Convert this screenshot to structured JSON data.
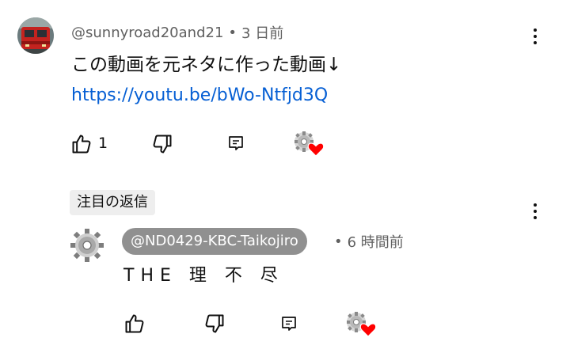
{
  "comment": {
    "author": "@sunnyroad20and21",
    "separator": "•",
    "time": "3 日前",
    "text": "この動画を元ネタに作った動画↓",
    "link": "https://youtu.be/bWo-Ntfjd3Q",
    "like_count": "1",
    "avatar_icon": "train-photo-avatar",
    "creator_heart_icon": "creator-heart-icon"
  },
  "reply": {
    "pinned_label": "注目の返信",
    "author": "@ND0429-KBC-Taikojiro",
    "separator": "•",
    "time": "6 時間前",
    "text": "THE 理 不 尽",
    "avatar_icon": "gear-avatar",
    "creator_heart_icon": "creator-heart-icon"
  },
  "colors": {
    "link": "#065fd4",
    "meta": "#606060",
    "heart": "#ff0000",
    "name_pill": "#909090",
    "chip_bg": "#eeeeee"
  }
}
